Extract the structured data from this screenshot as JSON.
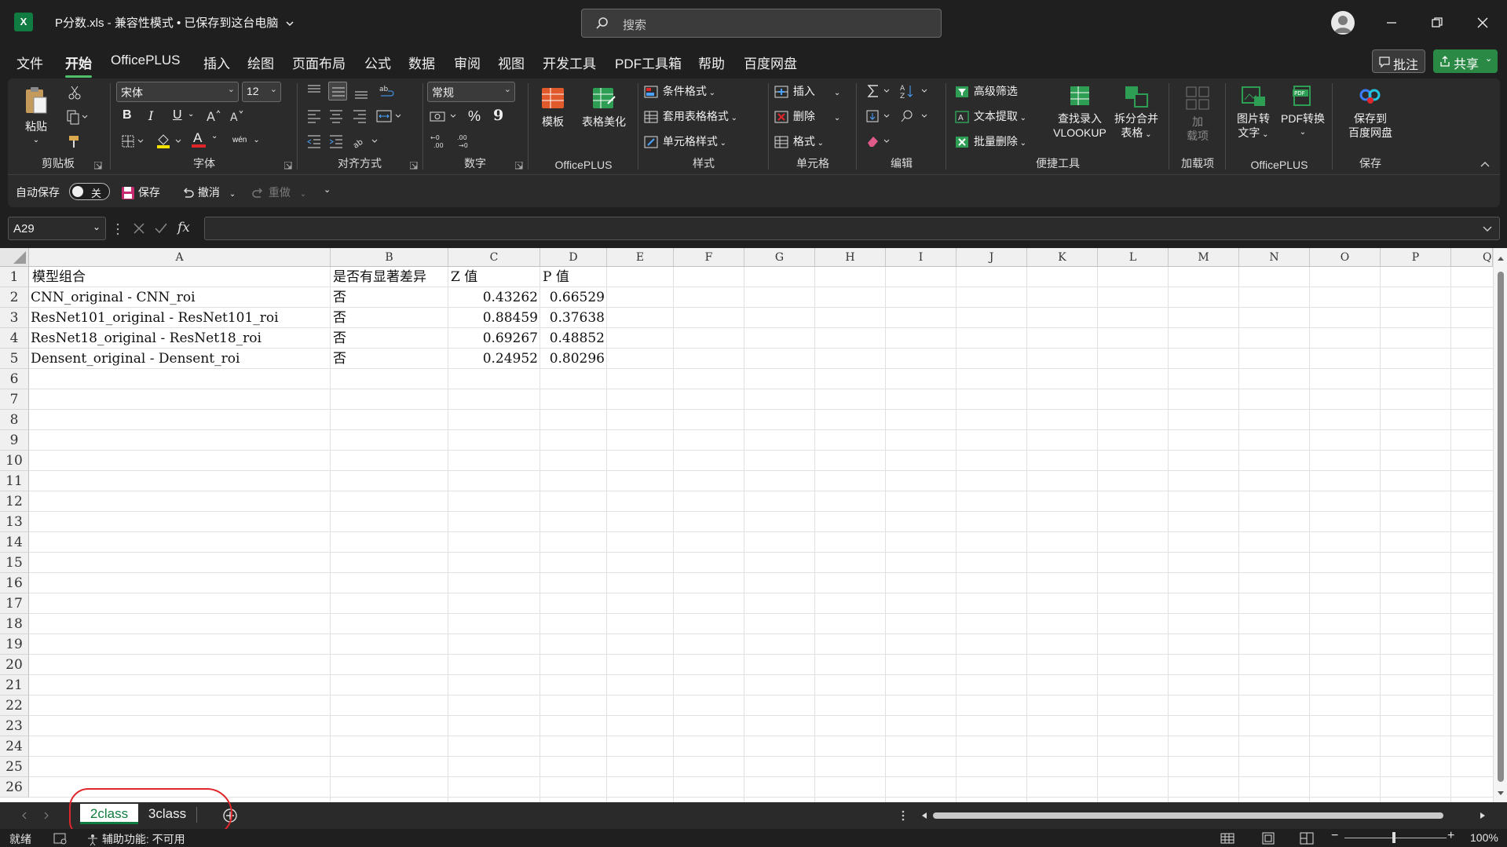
{
  "window": {
    "app_logo": "X",
    "title": "P分数.xls  -  兼容性模式 • 已保存到这台电脑",
    "search_placeholder": "搜索"
  },
  "menu": {
    "items": [
      "文件",
      "开始",
      "OfficePLUS",
      "插入",
      "绘图",
      "页面布局",
      "公式",
      "数据",
      "审阅",
      "视图",
      "开发工具",
      "PDF工具箱",
      "帮助",
      "百度网盘"
    ],
    "active": "开始",
    "comments_label": "批注",
    "share_label": "共享"
  },
  "ribbon": {
    "clipboard": {
      "paste": "粘贴",
      "label": "剪贴板"
    },
    "font": {
      "name": "宋体",
      "size": "12",
      "label": "字体",
      "bold": "B",
      "italic": "I",
      "underline": "U",
      "font_color": "A",
      "phonetic": "wén"
    },
    "alignment": {
      "label": "对齐方式"
    },
    "number": {
      "format": "常规",
      "label": "数字",
      "percent": "%",
      "comma": "9"
    },
    "officeplus": {
      "template": "模板",
      "beautify": "表格美化",
      "label": "OfficePLUS"
    },
    "styles": {
      "conditional": "条件格式",
      "table_format": "套用表格格式",
      "cell_style": "单元格样式",
      "label": "样式"
    },
    "cells": {
      "insert": "插入",
      "delete": "删除",
      "format": "格式",
      "label": "单元格"
    },
    "editing": {
      "label": "编辑"
    },
    "tools": {
      "advanced_filter": "高级筛选",
      "text_extract": "文本提取",
      "batch_delete": "批量删除",
      "vlookup_line1": "查找录入",
      "vlookup_line2": "VLOOKUP",
      "split_merge_line1": "拆分合并",
      "split_merge_line2": "表格",
      "label": "便捷工具"
    },
    "addins": {
      "btn_line1": "加",
      "btn_line2": "载项",
      "label": "加载项"
    },
    "officeplus2": {
      "img2text_line1": "图片转",
      "img2text_line2": "文字",
      "pdf_convert": "PDF转换",
      "label": "OfficePLUS"
    },
    "save": {
      "line1": "保存到",
      "line2": "百度网盘",
      "label": "保存"
    }
  },
  "qat": {
    "autosave": "自动保存",
    "toggle_state": "关",
    "save": "保存",
    "undo": "撤消",
    "redo": "重做"
  },
  "formula_bar": {
    "name_box": "A29",
    "fx": "fx",
    "value": ""
  },
  "sheet": {
    "columns": [
      "A",
      "B",
      "C",
      "D",
      "E",
      "F",
      "G",
      "H",
      "I",
      "J",
      "K",
      "L",
      "M",
      "N",
      "O",
      "P",
      "Q"
    ],
    "rows": [
      "1",
      "2",
      "3",
      "4",
      "5",
      "6",
      "7",
      "8",
      "9",
      "10",
      "11",
      "12",
      "13",
      "14",
      "15",
      "16",
      "17",
      "18",
      "19",
      "20",
      "21",
      "22",
      "23",
      "24",
      "25",
      "26"
    ],
    "header": {
      "a": "模型组合",
      "b": "是否有显著差异",
      "c": "Z 值",
      "d": "P 值"
    },
    "data": [
      {
        "a": "CNN_original - CNN_roi",
        "b": "否",
        "c": "0.43262",
        "d": "0.66529"
      },
      {
        "a": "ResNet101_original - ResNet101_roi",
        "b": "否",
        "c": "0.88459",
        "d": "0.37638"
      },
      {
        "a": "ResNet18_original - ResNet18_roi",
        "b": "否",
        "c": "0.69267",
        "d": "0.48852"
      },
      {
        "a": "Densent_original - Densent_roi",
        "b": "否",
        "c": "0.24952",
        "d": "0.80296"
      }
    ]
  },
  "tabs": [
    {
      "name": "2class",
      "active": true
    },
    {
      "name": "3class",
      "active": false
    }
  ],
  "status": {
    "ready": "就绪",
    "accessibility": "辅助功能: 不可用",
    "zoom": "100%"
  },
  "colors": {
    "excel_green": "#107c41",
    "share_green": "#2a8a45",
    "annotation_red": "#e0262b"
  }
}
